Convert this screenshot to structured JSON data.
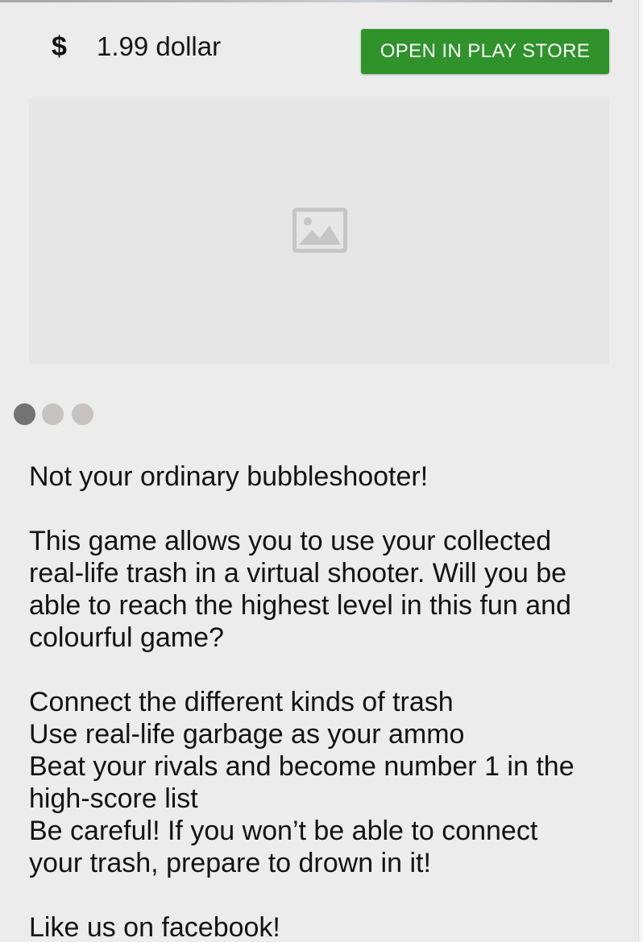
{
  "price": {
    "currency_icon": "dollar-sign-icon",
    "currency_symbol": "$",
    "amount_text": "1.99 dollar"
  },
  "store_button": {
    "label": "OPEN IN PLAY STORE",
    "color": "#2f922b"
  },
  "screenshot_carousel": {
    "placeholder_icon": "image-placeholder-icon",
    "dots": [
      {
        "active": true,
        "color": "#737373"
      },
      {
        "active": false,
        "color": "#c8c3c3"
      },
      {
        "active": false,
        "color": "#c8c3c3"
      }
    ]
  },
  "description": {
    "tagline": "Not your ordinary bubbleshooter!",
    "intro_lines": [
      "This game allows you to use your collected",
      "real-life trash in a virtual shooter. Will you be",
      "able to reach the highest level in this fun and",
      "colourful game?"
    ],
    "feature_lines": [
      "Connect the different kinds of trash",
      "Use real-life garbage as your ammo",
      "Beat your rivals and become number 1 in the",
      "high-score list",
      "Be careful! If you won’t be able to connect",
      "your trash, prepare to drown in it!"
    ],
    "closing": "Like us on facebook!"
  }
}
